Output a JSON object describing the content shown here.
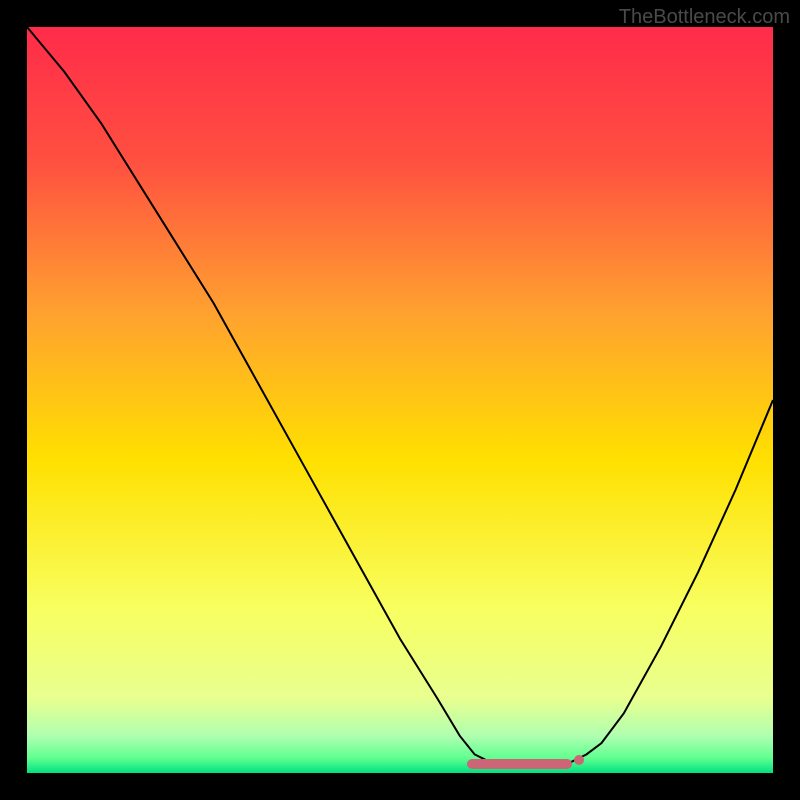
{
  "watermark": "TheBottleneck.com",
  "chart_data": {
    "type": "line",
    "title": "",
    "xlabel": "",
    "ylabel": "",
    "xlim": [
      0,
      100
    ],
    "ylim": [
      0,
      100
    ],
    "gradient_colors": {
      "top": "#ff2b4a",
      "upper_mid": "#ffa940",
      "mid": "#ffe000",
      "lower_mid": "#f8ff80",
      "bottom_band": "#d0ffb0",
      "bottom": "#00e080"
    },
    "curve_points": [
      [
        0,
        100
      ],
      [
        5,
        94
      ],
      [
        10,
        87
      ],
      [
        15,
        79
      ],
      [
        20,
        71
      ],
      [
        25,
        63
      ],
      [
        30,
        54
      ],
      [
        35,
        45
      ],
      [
        40,
        36
      ],
      [
        45,
        27
      ],
      [
        50,
        18
      ],
      [
        55,
        10
      ],
      [
        58,
        5
      ],
      [
        60,
        2.5
      ],
      [
        62,
        1.5
      ],
      [
        65,
        1.2
      ],
      [
        68,
        1.2
      ],
      [
        71,
        1.3
      ],
      [
        73,
        1.5
      ],
      [
        75,
        2.5
      ],
      [
        77,
        4
      ],
      [
        80,
        8
      ],
      [
        85,
        17
      ],
      [
        90,
        27
      ],
      [
        95,
        38
      ],
      [
        100,
        50
      ]
    ],
    "optimal_zone": {
      "start_x": 59,
      "end_x": 73,
      "y": 1.2
    },
    "marker": {
      "x": 74,
      "y": 1.8
    }
  }
}
